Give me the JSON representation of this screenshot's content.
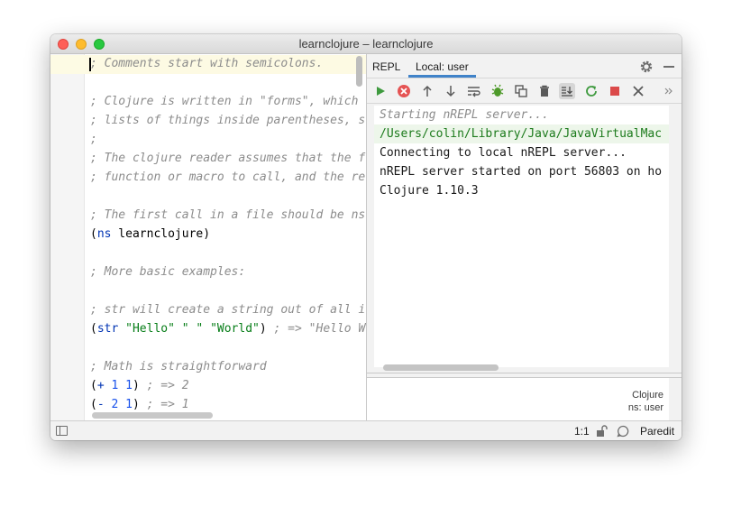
{
  "window": {
    "title": "learnclojure – learnclojure"
  },
  "editor": {
    "lines": [
      [
        {
          "t": "; Comments start with semicolons.",
          "c": "cmt"
        }
      ],
      [],
      [
        {
          "t": "; Clojure is written in \"forms\", which",
          "c": "cmt"
        }
      ],
      [
        {
          "t": "; lists of things inside parentheses, s",
          "c": "cmt"
        }
      ],
      [
        {
          "t": ";",
          "c": "cmt"
        }
      ],
      [
        {
          "t": "; The clojure reader assumes that the f",
          "c": "cmt"
        }
      ],
      [
        {
          "t": "; function or macro to call, and the re",
          "c": "cmt"
        }
      ],
      [],
      [
        {
          "t": "; The first call in a file should be ns",
          "c": "cmt"
        }
      ],
      [
        {
          "t": "(",
          "c": "paren"
        },
        {
          "t": "ns",
          "c": "kw"
        },
        {
          "t": " learnclojure",
          "c": "sym"
        },
        {
          "t": ")",
          "c": "paren"
        }
      ],
      [],
      [
        {
          "t": "; More basic examples:",
          "c": "cmt"
        }
      ],
      [],
      [
        {
          "t": "; str will create a string out of all i",
          "c": "cmt"
        }
      ],
      [
        {
          "t": "(",
          "c": "paren"
        },
        {
          "t": "str",
          "c": "kw"
        },
        {
          "t": " ",
          "c": "sym"
        },
        {
          "t": "\"Hello\"",
          "c": "str"
        },
        {
          "t": " ",
          "c": "sym"
        },
        {
          "t": "\" \"",
          "c": "str"
        },
        {
          "t": " ",
          "c": "sym"
        },
        {
          "t": "\"World\"",
          "c": "str"
        },
        {
          "t": ")",
          "c": "paren"
        },
        {
          "t": " ; => \"Hello W",
          "c": "cmt"
        }
      ],
      [],
      [
        {
          "t": "; Math is straightforward",
          "c": "cmt"
        }
      ],
      [
        {
          "t": "(",
          "c": "paren"
        },
        {
          "t": "+",
          "c": "kw"
        },
        {
          "t": " ",
          "c": "sym"
        },
        {
          "t": "1",
          "c": "num"
        },
        {
          "t": " ",
          "c": "sym"
        },
        {
          "t": "1",
          "c": "num"
        },
        {
          "t": ")",
          "c": "paren"
        },
        {
          "t": " ; => 2",
          "c": "cmt"
        }
      ],
      [
        {
          "t": "(",
          "c": "paren"
        },
        {
          "t": "-",
          "c": "kw"
        },
        {
          "t": " ",
          "c": "sym"
        },
        {
          "t": "2",
          "c": "num"
        },
        {
          "t": " ",
          "c": "sym"
        },
        {
          "t": "1",
          "c": "num"
        },
        {
          "t": ")",
          "c": "paren"
        },
        {
          "t": " ; => 1",
          "c": "cmt"
        }
      ]
    ]
  },
  "repl": {
    "tab_title": "REPL",
    "tab_local": "Local: user",
    "output": [
      {
        "text": "Starting nREPL server...",
        "style": "out-italic"
      },
      {
        "text": "/Users/colin/Library/Java/JavaVirtualMac",
        "style": "out-path"
      },
      {
        "text": "Connecting to local nREPL server...",
        "style": "out-normal"
      },
      {
        "text": "nREPL server started on port 56803 on ho",
        "style": "out-normal"
      },
      {
        "text": "Clojure 1.10.3",
        "style": "out-normal"
      }
    ],
    "info_language": "Clojure",
    "info_namespace": "ns: user"
  },
  "status": {
    "position": "1:1",
    "mode": "Paredit"
  }
}
